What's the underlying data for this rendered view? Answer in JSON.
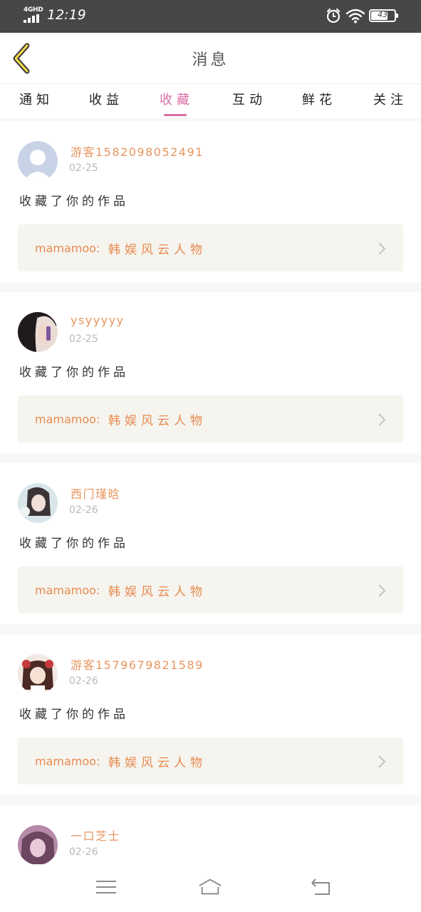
{
  "status_bar": {
    "network": "4GHD",
    "time": "12:19",
    "battery": "43",
    "icons": [
      "signal-icon",
      "alarm-icon",
      "wifi-icon",
      "battery-icon"
    ]
  },
  "header": {
    "title": "消息",
    "back_icon": "chevron-left-icon"
  },
  "tabs": [
    {
      "label": "通知",
      "active": false
    },
    {
      "label": "收益",
      "active": false
    },
    {
      "label": "收藏",
      "active": true
    },
    {
      "label": "互动",
      "active": false
    },
    {
      "label": "鲜花",
      "active": false
    },
    {
      "label": "关注",
      "active": false
    }
  ],
  "messages": [
    {
      "user": "游客15820980524​91",
      "date": "02-25",
      "action": "收藏了你的作品",
      "author": "mamamoo:",
      "work_title": "韩娱风云人物",
      "avatar": "default-avatar-icon"
    },
    {
      "user": "ysyyyyy",
      "date": "02-25",
      "action": "收藏了你的作品",
      "author": "mamamoo:",
      "work_title": "韩娱风云人物",
      "avatar": "user-photo"
    },
    {
      "user": "西门瑾晗",
      "date": "02-26",
      "action": "收藏了你的作品",
      "author": "mamamoo:",
      "work_title": "韩娱风云人物",
      "avatar": "user-photo"
    },
    {
      "user": "游客1579679821589",
      "date": "02-26",
      "action": "收藏了你的作品",
      "author": "mamamoo:",
      "work_title": "韩娱风云人物",
      "avatar": "user-photo"
    },
    {
      "user": "一口芝士",
      "date": "02-26",
      "action": "",
      "author": "",
      "work_title": "",
      "avatar": "user-photo"
    }
  ],
  "colors": {
    "accent": "#d96ea5",
    "username": "#e7965f",
    "work_text": "#e88b52",
    "work_bg": "#f5f4ee",
    "status_bar": "#474747"
  },
  "navbar": {
    "icons": [
      "menu-icon",
      "home-icon",
      "back-icon"
    ]
  }
}
